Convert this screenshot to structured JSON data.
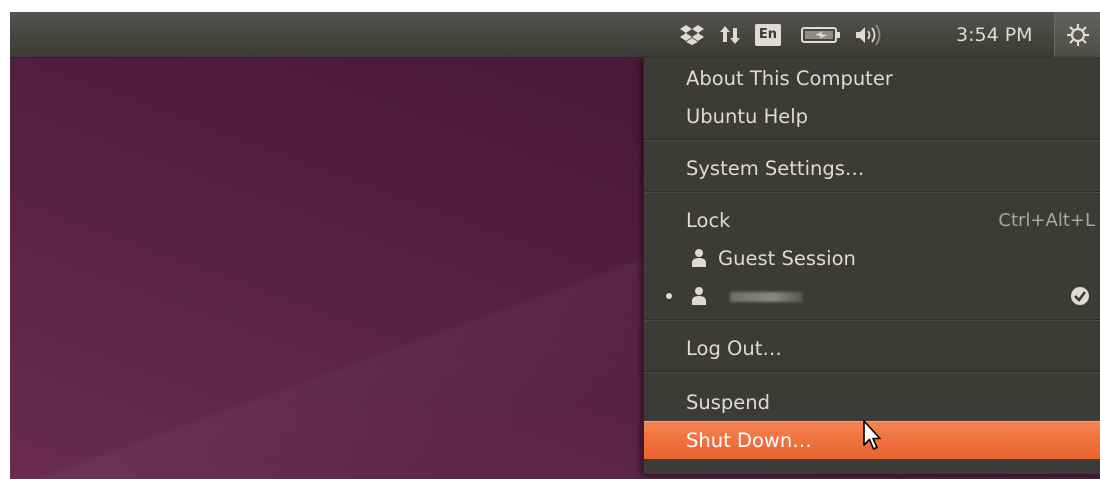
{
  "panel": {
    "clock": "3:54 PM",
    "keyboard_layout": "En",
    "icons": [
      "dropbox-icon",
      "network-icon",
      "keyboard-layout-icon",
      "battery-icon",
      "sound-icon",
      "session-gear-icon"
    ]
  },
  "menu": {
    "about": "About This Computer",
    "help": "Ubuntu Help",
    "settings": "System Settings…",
    "lock": "Lock",
    "lock_shortcut": "Ctrl+Alt+L",
    "guest": "Guest Session",
    "logout": "Log Out…",
    "suspend": "Suspend",
    "shutdown": "Shut Down…"
  },
  "colors": {
    "panel": "#3c3b37",
    "menu_bg": "#3c3b37",
    "menu_text": "#dfdbd2",
    "highlight": "#e9622f",
    "desktop": "#4c1a3c"
  }
}
